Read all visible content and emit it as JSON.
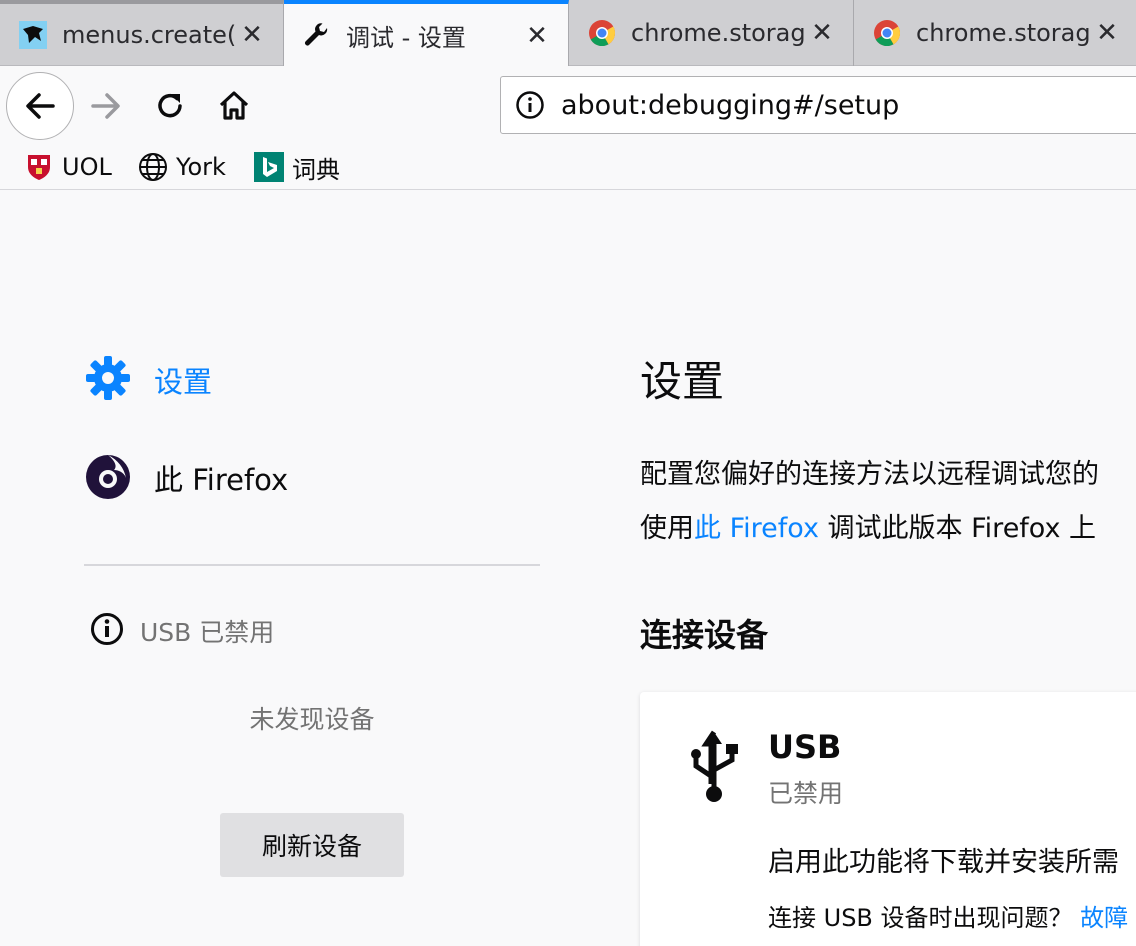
{
  "tabs": [
    {
      "title": "menus.create(",
      "favicon": "mdn-dino-icon",
      "close": "✕"
    },
    {
      "title": "调试 - 设置",
      "favicon": "wrench-icon",
      "close": "✕"
    },
    {
      "title": "chrome.storag",
      "favicon": "chrome-icon",
      "close": "✕"
    },
    {
      "title": "chrome.storag",
      "favicon": "chrome-icon",
      "close": "✕"
    }
  ],
  "navbar": {
    "url": "about:debugging#/setup"
  },
  "bookmarks": [
    {
      "label": "UOL",
      "icon": "uol-crest-icon"
    },
    {
      "label": "York",
      "icon": "globe-icon"
    },
    {
      "label": "词典",
      "icon": "bing-icon"
    }
  ],
  "sidebar": {
    "setup_label": "设置",
    "this_firefox_label": "此 Firefox",
    "usb_status": "USB 已禁用",
    "no_devices": "未发现设备",
    "refresh_button": "刷新设备"
  },
  "main": {
    "title": "设置",
    "description_line1": "配置您偏好的连接方法以远程调试您的",
    "description_line2_prefix": "使用",
    "description_line2_link": "此 Firefox",
    "description_line2_suffix": " 调试此版本 Firefox 上",
    "connect_heading": "连接设备",
    "usb_card": {
      "title": "USB",
      "status": "已禁用",
      "description": "启用此功能将下载并安装所需",
      "trouble_text": "连接 USB 设备时出现问题？",
      "trouble_link": "故障"
    }
  },
  "colors": {
    "accent": "#0a84ff",
    "tab_strip": "#cfcfd2",
    "background": "#f9f9fa",
    "muted_text": "#737373"
  }
}
